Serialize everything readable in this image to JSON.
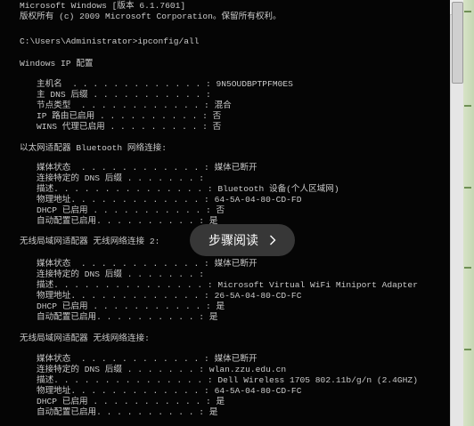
{
  "console": {
    "line_01": "Microsoft Windows [版本 6.1.7601]",
    "line_02": "版权所有 (c) 2009 Microsoft Corporation。保留所有权利。",
    "prompt": "C:\\Users\\Administrator>ipconfig/all",
    "windows_ip_header": "Windows IP 配置",
    "ip": {
      "host": "主机名  . . . . . . . . . . . . . : 9N5OUDBPTPFM0ES",
      "primary_dns": "主 DNS 后缀 . . . . . . . . . . . :",
      "node_type": "节点类型  . . . . . . . . . . . . : 混合",
      "ip_routing": "IP 路由已启用 . . . . . . . . . . : 否",
      "wins_proxy": "WINS 代理已启用 . . . . . . . . . : 否"
    },
    "bt": {
      "header": "以太网适配器 Bluetooth 网络连接:",
      "media_state": "媒体状态  . . . . . . . . . . . . : 媒体已断开",
      "conn_dns": "连接特定的 DNS 后缀 . . . . . . . :",
      "desc": "描述. . . . . . . . . . . . . . . : Bluetooth 设备(个人区域网)",
      "phys": "物理地址. . . . . . . . . . . . . : 64-5A-04-80-CD-FD",
      "dhcp": "DHCP 已启用 . . . . . . . . . . . : 否",
      "autoconf": "自动配置已启用. . . . . . . . . . : 是"
    },
    "wlan2": {
      "header": "无线局域网适配器 无线网络连接 2:",
      "media_state": "媒体状态  . . . . . . . . . . . . : 媒体已断开",
      "conn_dns": "连接特定的 DNS 后缀 . . . . . . . :",
      "desc": "描述. . . . . . . . . . . . . . . : Microsoft Virtual WiFi Miniport Adapter",
      "phys": "物理地址. . . . . . . . . . . . . : 26-5A-04-80-CD-FC",
      "dhcp": "DHCP 已启用 . . . . . . . . . . . : 是",
      "autoconf": "自动配置已启用. . . . . . . . . . : 是"
    },
    "wlan": {
      "header": "无线局域网适配器 无线网络连接:",
      "media_state": "媒体状态  . . . . . . . . . . . . : 媒体已断开",
      "conn_dns": "连接特定的 DNS 后缀 . . . . . . . : wlan.zzu.edu.cn",
      "desc": "描述. . . . . . . . . . . . . . . : Dell Wireless 1705 802.11b/g/n (2.4GHZ)",
      "phys": "物理地址. . . . . . . . . . . . . : 64-5A-04-80-CD-FC",
      "dhcp": "DHCP 已启用 . . . . . . . . . . . : 是",
      "autoconf": "自动配置已启用. . . . . . . . . . : 是"
    }
  },
  "overlay": {
    "step_label": "步骤阅读",
    "chevron_icon": "chevron-right-icon"
  },
  "scrollbar": {
    "up_arrow_icon": "scroll-up-arrow-icon"
  },
  "colors": {
    "console_bg": "#050505",
    "console_text": "#c9c9c9",
    "pill_bg": "#3c3c3c"
  }
}
